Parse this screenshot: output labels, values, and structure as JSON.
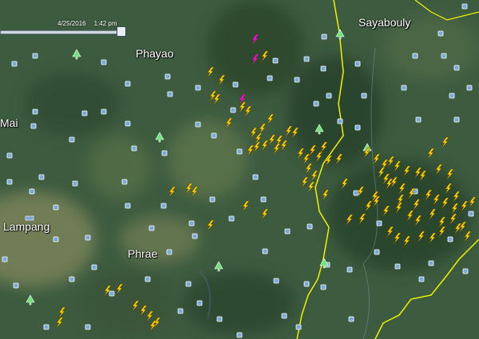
{
  "timestamp": {
    "date": "4/25/2016",
    "time": "1:42 pm"
  },
  "cities": [
    {
      "label": "Sayabouly"
    },
    {
      "label": "Phayao"
    },
    {
      "label": "Mai"
    },
    {
      "label": "Lampang"
    },
    {
      "label": "Phrae"
    }
  ],
  "colors": {
    "terrain": "#3c5a3e",
    "border": "#f2f200",
    "lightning_recent": "#ff00ff",
    "lightning": "#ffd000",
    "station": "#7aa9d8",
    "park": "#6fe37a"
  },
  "icons": {
    "lightning": "lightning-bolt-icon",
    "station": "weather-station-icon",
    "park": "park-tree-icon"
  }
}
